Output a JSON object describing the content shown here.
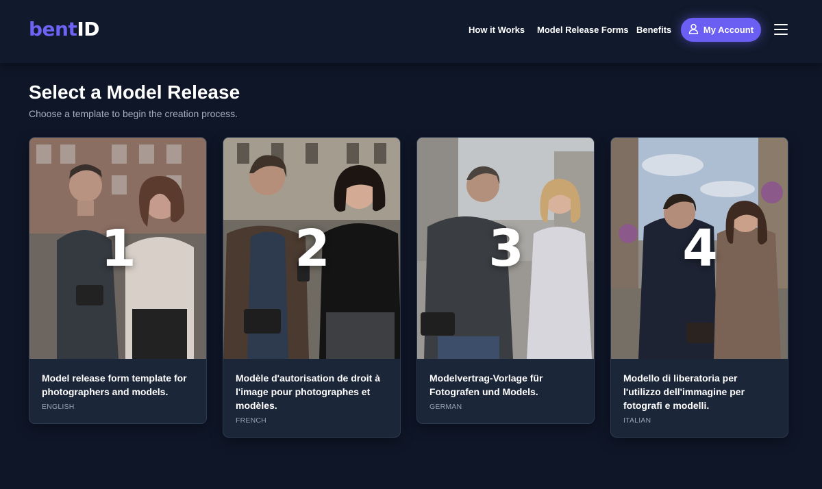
{
  "header": {
    "logo": {
      "part1": "bent",
      "part2": "ID"
    },
    "nav": {
      "how_it_works": "How it Works",
      "model_release_forms": "Model Release Forms",
      "benefits": "Benefits"
    },
    "account_button": "My Account",
    "menu_icon": "hamburger-menu-icon",
    "account_icon": "user-icon"
  },
  "main": {
    "title": "Select a Model Release",
    "subtitle": "Choose a template to begin the creation process."
  },
  "cards": [
    {
      "number": "1",
      "title": "Model release form template for photographers and models.",
      "language": "ENGLISH"
    },
    {
      "number": "2",
      "title": "Modèle d'autorisation de droit à l'image pour photographes et modèles.",
      "language": "FRENCH"
    },
    {
      "number": "3",
      "title": "Modelvertrag-Vorlage für Fotografen und Models.",
      "language": "GERMAN"
    },
    {
      "number": "4",
      "title": "Modello di liberatoria per l'utilizzo dell'immagine per fotografi e modelli.",
      "language": "ITALIAN"
    }
  ],
  "colors": {
    "background": "#0f1627",
    "header_bg": "#111a2c",
    "accent": "#6a5ff2",
    "logo_accent": "#6d63f5",
    "card_bg": "#1c2639",
    "muted_text": "#a7afbd"
  }
}
